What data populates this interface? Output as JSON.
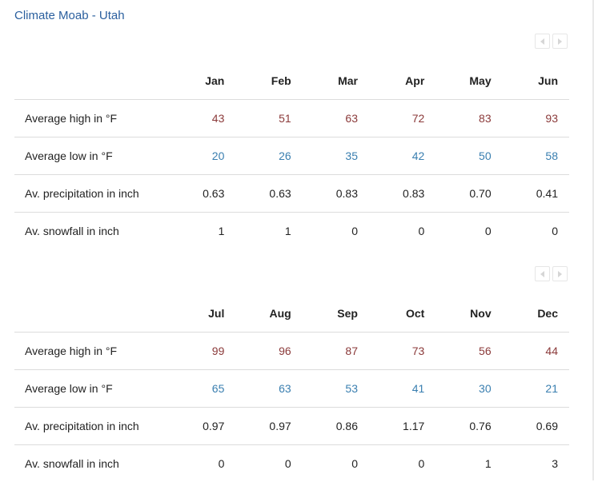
{
  "title": "Climate Moab - Utah",
  "row_labels": {
    "high": "Average high in °F",
    "low": "Average low in °F",
    "precip": "Av. precipitation in inch",
    "snow": "Av. snowfall in inch"
  },
  "colors": {
    "title": "#2a5f9e",
    "high": "#8b3a3a",
    "low": "#3a7fb0"
  },
  "tables": [
    {
      "months": [
        "Jan",
        "Feb",
        "Mar",
        "Apr",
        "May",
        "Jun"
      ],
      "high": [
        "43",
        "51",
        "63",
        "72",
        "83",
        "93"
      ],
      "low": [
        "20",
        "26",
        "35",
        "42",
        "50",
        "58"
      ],
      "precip": [
        "0.63",
        "0.63",
        "0.83",
        "0.83",
        "0.70",
        "0.41"
      ],
      "snow": [
        "1",
        "1",
        "0",
        "0",
        "0",
        "0"
      ]
    },
    {
      "months": [
        "Jul",
        "Aug",
        "Sep",
        "Oct",
        "Nov",
        "Dec"
      ],
      "high": [
        "99",
        "96",
        "87",
        "73",
        "56",
        "44"
      ],
      "low": [
        "65",
        "63",
        "53",
        "41",
        "30",
        "21"
      ],
      "precip": [
        "0.97",
        "0.97",
        "0.86",
        "1.17",
        "0.76",
        "0.69"
      ],
      "snow": [
        "0",
        "0",
        "0",
        "0",
        "1",
        "3"
      ]
    }
  ]
}
